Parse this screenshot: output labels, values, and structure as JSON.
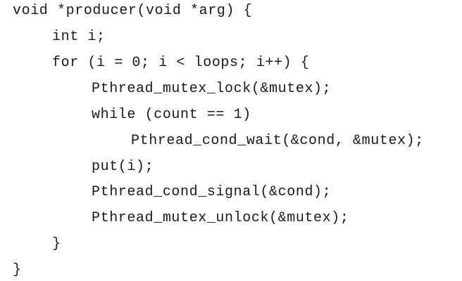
{
  "code": {
    "lines": [
      "void *producer(void *arg) {",
      "int i;",
      "for (i = 0; i < loops; i++) {",
      "Pthread_mutex_lock(&mutex);",
      "while (count == 1)",
      "Pthread_cond_wait(&cond, &mutex);",
      "put(i);",
      "Pthread_cond_signal(&cond);",
      "Pthread_mutex_unlock(&mutex);",
      "}",
      "}"
    ]
  }
}
